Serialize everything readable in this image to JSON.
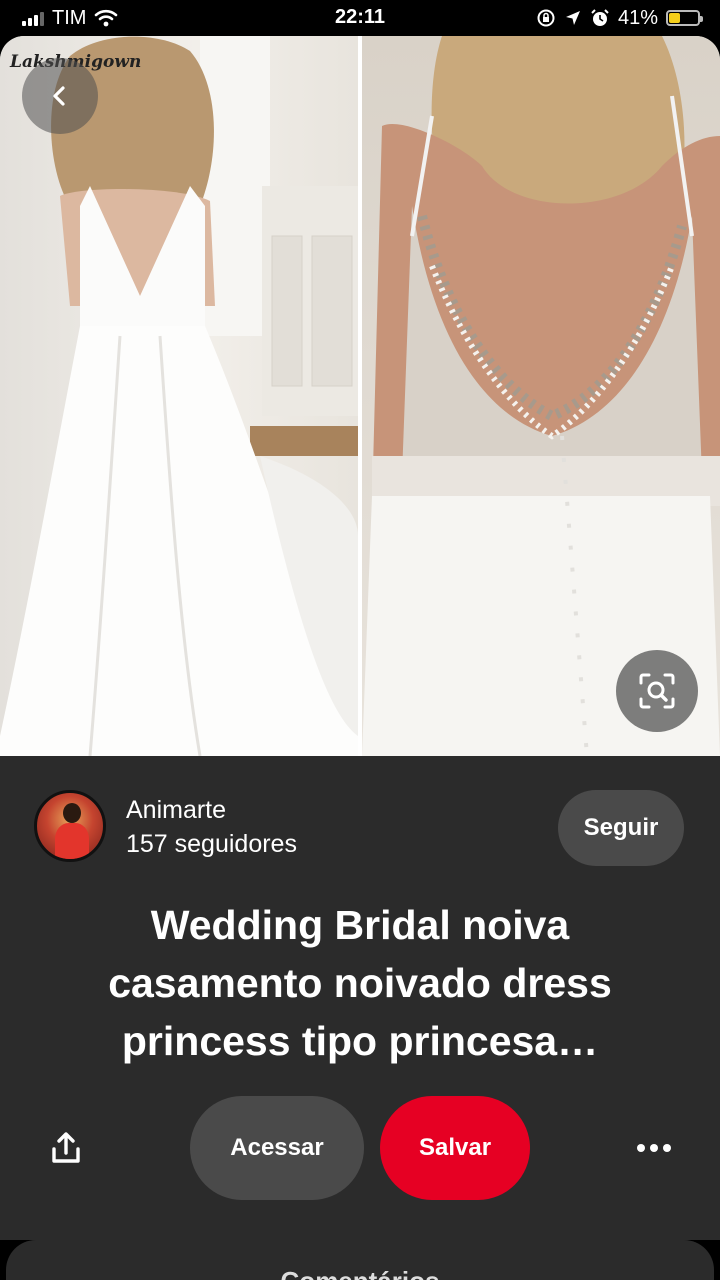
{
  "status_bar": {
    "carrier": "TIM",
    "time": "22:11",
    "battery": "41%",
    "battery_level": 0.41,
    "battery_color": "#f5cf1a"
  },
  "pin": {
    "watermark": "Lakshmigown",
    "creator_name": "Animarte",
    "followers": "157 seguidores",
    "follow_label": "Seguir",
    "title": "Wedding Bridal noiva casamento noivado dress princess tipo princesa…"
  },
  "actions": {
    "visit_label": "Acessar",
    "save_label": "Salvar",
    "save_color": "#e60023"
  },
  "comments": {
    "label": "Comentários"
  },
  "icons": {
    "back": "chevron-left-icon",
    "lens": "visual-search-icon",
    "share": "share-icon",
    "more": "more-horizontal-icon"
  }
}
